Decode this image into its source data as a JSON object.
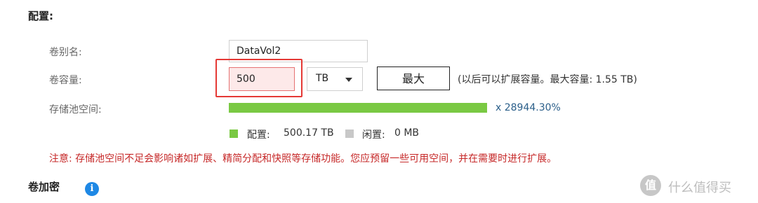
{
  "section": {
    "title": "配置:"
  },
  "volume_alias": {
    "label": "卷别名:",
    "value": "DataVol2"
  },
  "volume_capacity": {
    "label": "卷容量:",
    "value": "500",
    "unit": "TB",
    "max_button": "最大",
    "hint": "(以后可以扩展容量。最大容量: 1.55 TB)"
  },
  "pool_space": {
    "label": "存储池空间:",
    "usage_percent_text": "x 28944.30%",
    "fill_fraction": 1.0,
    "fill_color": "#7ac943"
  },
  "legend": {
    "configured": {
      "label": "配置:",
      "value": "500.17 TB",
      "color": "#7ac943"
    },
    "free": {
      "label": "闲置:",
      "value": "0 MB",
      "color": "#c8c8c8"
    }
  },
  "warning": "注意: 存储池空间不足会影响诸如扩展、精简分配和快照等存储功能。您应预留一些可用空间，并在需要时进行扩展。",
  "encryption": {
    "title": "卷加密",
    "info_icon": "info-icon"
  },
  "watermark": {
    "logo_text": "值",
    "text": "什么值得买"
  }
}
